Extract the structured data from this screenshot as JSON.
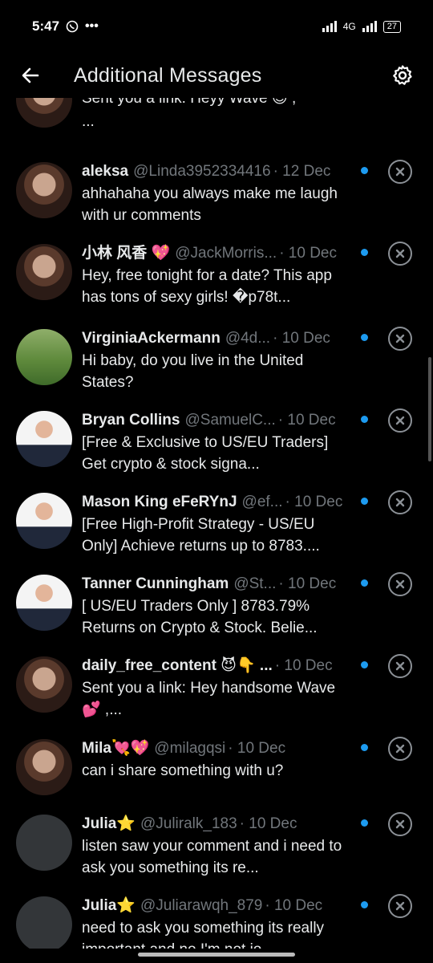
{
  "status": {
    "time": "5:47",
    "network": "4G",
    "battery": "27"
  },
  "header": {
    "title": "Additional Messages",
    "back_icon": "arrow-left-icon",
    "settings_icon": "gear-icon"
  },
  "colors": {
    "background": "#000000",
    "primary_text": "#e7e9ea",
    "secondary_text": "#71767b",
    "unread_dot": "#1d9bf0"
  },
  "messages": [
    {
      "name": "",
      "handle": "",
      "time": "",
      "text": "Sent you a link: Heyy Wave 😍 ,",
      "text2": "...",
      "avatar": "photo-woman",
      "unread": false
    },
    {
      "name": "aleksa",
      "handle": "@Linda3952334416",
      "time": "· 12 Dec",
      "text": "ahhahaha you always make me laugh with ur comments",
      "avatar": "photo-woman",
      "unread": true
    },
    {
      "name": "小林 风香 💖",
      "handle": "@JackMorris...",
      "time": "· 10 Dec",
      "text": "Hey, free tonight for a date? This app has tons of sexy girls! �p78t...",
      "avatar": "photo-woman",
      "unread": true
    },
    {
      "name": "VirginiaAckermann",
      "handle": "@4d...",
      "time": "· 10 Dec",
      "text": "Hi baby, do you live in the United States?",
      "avatar": "photo-outdoor",
      "unread": true
    },
    {
      "name": "Bryan Collins",
      "handle": "@SamuelC...",
      "time": "· 10 Dec",
      "text": "[Free & Exclusive to US/EU Traders] Get crypto & stock signa...",
      "avatar": "photo-man-suit",
      "unread": true
    },
    {
      "name": "Mason King eFeRYnJ",
      "handle": "@ef...",
      "time": "· 10 Dec",
      "text": "[Free High-Profit Strategy - US/EU Only] Achieve returns up to 8783....",
      "avatar": "photo-man-suit",
      "unread": true
    },
    {
      "name": "Tanner Cunningham",
      "handle": "@St...",
      "time": "· 10 Dec",
      "text": "[ US/EU Traders Only ] 8783.79% Returns on Crypto & Stock. Belie...",
      "avatar": "photo-man-suit",
      "unread": true
    },
    {
      "name": "daily_free_content 😈👇 ...",
      "handle": "",
      "time": "· 10 Dec",
      "text": "Sent you a link: Hey handsome Wave 💕 ,...",
      "avatar": "photo-woman",
      "unread": true
    },
    {
      "name": "Mila💘💖",
      "handle": "@milagqsi",
      "time": "· 10 Dec",
      "text": "can i share something with u?",
      "avatar": "photo-woman",
      "unread": true
    },
    {
      "name": "Julia⭐",
      "handle": "@Juliralk_183",
      "time": "· 10 Dec",
      "text": "listen saw your comment and i need to ask you something its re...",
      "avatar": "placeholder",
      "unread": true
    },
    {
      "name": "Julia⭐",
      "handle": "@Juliarawqh_879",
      "time": "· 10 Dec",
      "text": "need to ask you something its really important and no I'm not jo...",
      "avatar": "placeholder",
      "unread": true
    }
  ]
}
